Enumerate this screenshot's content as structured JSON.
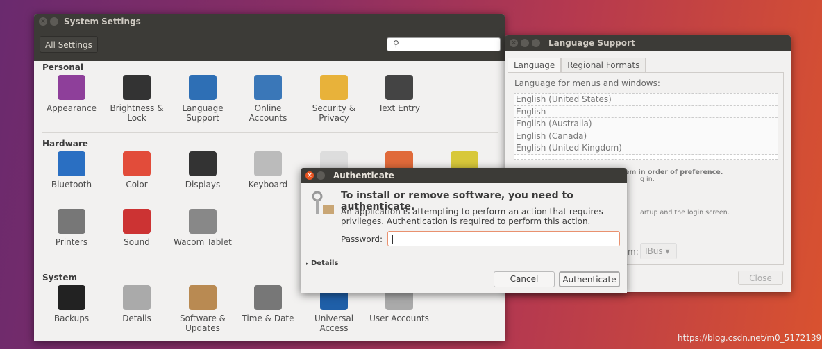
{
  "system_settings": {
    "title": "System Settings",
    "all_settings": "All Settings",
    "search_placeholder": "",
    "sections": [
      {
        "label": "Personal",
        "items": [
          {
            "label": "Appearance",
            "icon": "appearance-icon"
          },
          {
            "label": "Brightness & Lock",
            "icon": "lock-icon"
          },
          {
            "label": "Language Support",
            "icon": "flag-icon"
          },
          {
            "label": "Online Accounts",
            "icon": "online-accounts-icon"
          },
          {
            "label": "Security & Privacy",
            "icon": "security-icon"
          },
          {
            "label": "Text Entry",
            "icon": "keyboard-keys-icon"
          }
        ]
      },
      {
        "label": "Hardware",
        "items": [
          {
            "label": "Bluetooth",
            "icon": "bluetooth-icon"
          },
          {
            "label": "Color",
            "icon": "color-icon"
          },
          {
            "label": "Displays",
            "icon": "display-icon"
          },
          {
            "label": "Keyboard",
            "icon": "keyboard-icon"
          },
          {
            "label": "Printers",
            "icon": "printer-icon"
          },
          {
            "label": "Sound",
            "icon": "sound-icon"
          },
          {
            "label": "Wacom Tablet",
            "icon": "tablet-icon"
          }
        ]
      },
      {
        "label": "System",
        "items": [
          {
            "label": "Backups",
            "icon": "backup-icon"
          },
          {
            "label": "Details",
            "icon": "gear-icon"
          },
          {
            "label": "Software & Updates",
            "icon": "software-icon"
          },
          {
            "label": "Time & Date",
            "icon": "clock-icon"
          },
          {
            "label": "Universal Access",
            "icon": "accessibility-icon"
          },
          {
            "label": "User Accounts",
            "icon": "users-icon"
          }
        ]
      }
    ]
  },
  "language_support": {
    "title": "Language Support",
    "tabs": [
      "Language",
      "Regional Formats"
    ],
    "list_label": "Language for menus and windows:",
    "languages": [
      "English (United States)",
      "English",
      "English (Australia)",
      "English (Canada)",
      "English (United Kingdom)"
    ],
    "hint1": "Drag languages to arrange them in order of preference.",
    "hint2": "g in.",
    "hint3": "artup and the login screen.",
    "im_label": "m:",
    "im_value": "IBus",
    "close": "Close"
  },
  "auth": {
    "title": "Authenticate",
    "heading": "To install or remove software, you need to authenticate.",
    "description": "An application is attempting to perform an action that requires privileges. Authentication is required to perform this action.",
    "password_label": "Password:",
    "password_value": "",
    "details": "Details",
    "cancel": "Cancel",
    "authenticate": "Authenticate"
  },
  "watermark": "https://blog.csdn.net/m0_51721395",
  "colors": {
    "accent": "#e95420",
    "titlebar": "#3c3b37"
  }
}
